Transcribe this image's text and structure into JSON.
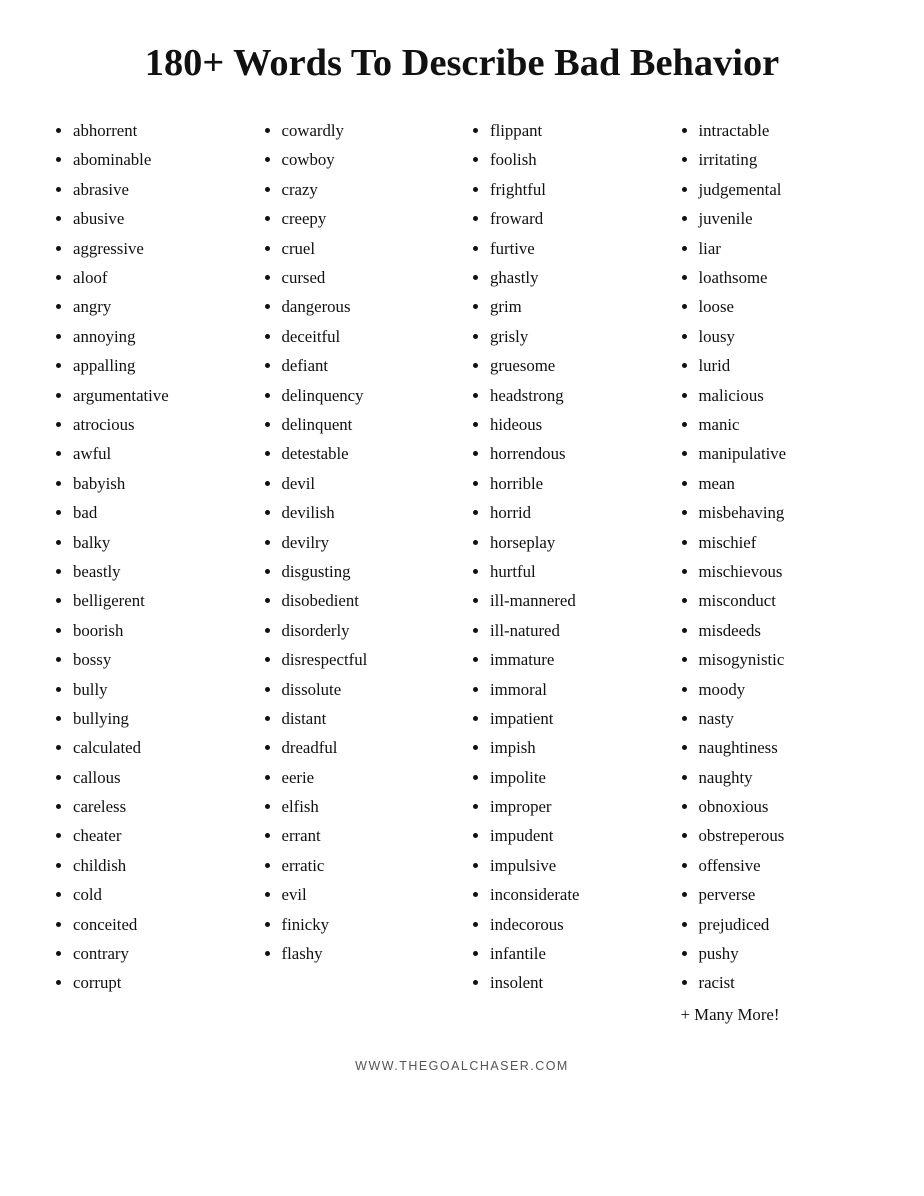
{
  "title": "180+ Words To Describe Bad Behavior",
  "columns": [
    {
      "words": [
        "abhorrent",
        "abominable",
        "abrasive",
        "abusive",
        "aggressive",
        "aloof",
        "angry",
        "annoying",
        "appalling",
        "argumentative",
        "atrocious",
        "awful",
        "babyish",
        "bad",
        "balky",
        "beastly",
        "belligerent",
        "boorish",
        "bossy",
        "bully",
        "bullying",
        "calculated",
        "callous",
        "careless",
        "cheater",
        "childish",
        "cold",
        "conceited",
        "contrary",
        "corrupt"
      ]
    },
    {
      "words": [
        "cowardly",
        "cowboy",
        "crazy",
        "creepy",
        "cruel",
        "cursed",
        "dangerous",
        "deceitful",
        "defiant",
        "delinquency",
        "delinquent",
        "detestable",
        "devil",
        "devilish",
        "devilry",
        "disgusting",
        "disobedient",
        "disorderly",
        "disrespectful",
        "dissolute",
        "distant",
        "dreadful",
        "eerie",
        "elfish",
        "errant",
        "erratic",
        "evil",
        "finicky",
        "flashy"
      ]
    },
    {
      "words": [
        "flippant",
        "foolish",
        "frightful",
        "froward",
        "furtive",
        "ghastly",
        "grim",
        "grisly",
        "gruesome",
        "headstrong",
        "hideous",
        "horrendous",
        "horrible",
        "horrid",
        "horseplay",
        "hurtful",
        "ill-mannered",
        "ill-natured",
        "immature",
        "immoral",
        "impatient",
        "impish",
        "impolite",
        "improper",
        "impudent",
        "impulsive",
        "inconsiderate",
        "indecorous",
        "infantile",
        "insolent"
      ]
    },
    {
      "words": [
        "intractable",
        "irritating",
        "judgemental",
        "juvenile",
        "liar",
        "loathsome",
        "loose",
        "lousy",
        "lurid",
        "malicious",
        "manic",
        "manipulative",
        "mean",
        "misbehaving",
        "mischief",
        "mischievous",
        "misconduct",
        "misdeeds",
        "misogynistic",
        "moody",
        "nasty",
        "naughtiness",
        "naughty",
        "obnoxious",
        "obstreperous",
        "offensive",
        "perverse",
        "prejudiced",
        "pushy",
        "racist"
      ]
    }
  ],
  "more_label": "+ Many More!",
  "footer": "WWW.THEGOALCHASER.COM"
}
